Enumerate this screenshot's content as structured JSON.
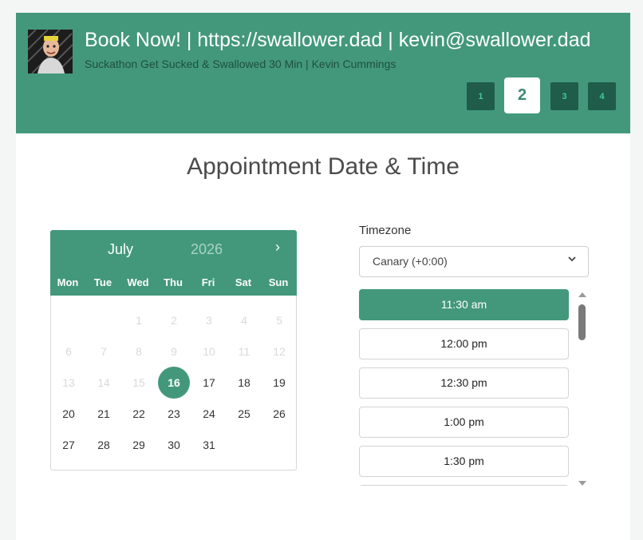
{
  "header": {
    "title": "Book Now! | https://swallower.dad | kevin@swallower.dad",
    "subtitle": "Suckathon Get Sucked & Swallowed 30 Min | Kevin Cummings",
    "steps": [
      "1",
      "2",
      "3",
      "4"
    ],
    "active_step": "2"
  },
  "page_title": "Appointment Date & Time",
  "calendar": {
    "month": "July",
    "year": "2026",
    "next_icon": "chevron-right-icon",
    "weekdays": [
      "Mon",
      "Tue",
      "Wed",
      "Thu",
      "Fri",
      "Sat",
      "Sun"
    ],
    "weeks": [
      [
        "",
        "",
        "1",
        "2",
        "3",
        "4",
        "5"
      ],
      [
        "6",
        "7",
        "8",
        "9",
        "10",
        "11",
        "12"
      ],
      [
        "13",
        "14",
        "15",
        "16",
        "17",
        "18",
        "19"
      ],
      [
        "20",
        "21",
        "22",
        "23",
        "24",
        "25",
        "26"
      ],
      [
        "27",
        "28",
        "29",
        "30",
        "31",
        "",
        ""
      ]
    ],
    "selected": "16",
    "first_available": "16"
  },
  "timezone": {
    "label": "Timezone",
    "value": "Canary (+0:00)",
    "chevron_icon": "chevron-down-icon"
  },
  "time_slots": [
    "11:30 am",
    "12:00 pm",
    "12:30 pm",
    "1:00 pm",
    "1:30 pm"
  ],
  "selected_slot": "11:30 am",
  "colors": {
    "accent": "#43987c",
    "step_inactive": "#1f5c49",
    "text_dark": "#333333"
  }
}
